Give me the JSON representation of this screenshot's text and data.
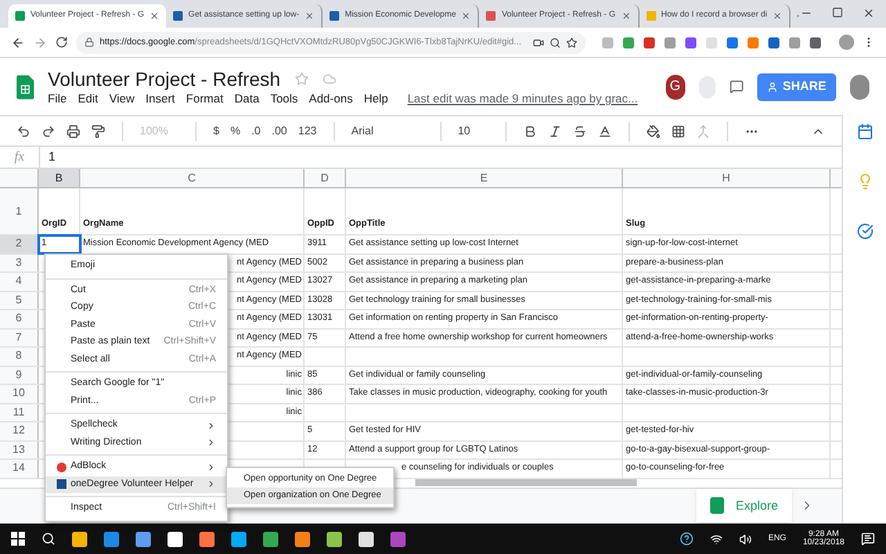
{
  "browser": {
    "tabs": [
      {
        "title": "Volunteer Project - Refresh - G",
        "selected": true,
        "color": "#0f9d58"
      },
      {
        "title": "Get assistance setting up low-",
        "selected": false,
        "color": "#1a5fa8"
      },
      {
        "title": "Mission Economic Developme",
        "selected": false,
        "color": "#1a5fa8"
      },
      {
        "title": "Volunteer Project - Refresh - G",
        "selected": false,
        "color": "#d9534f"
      },
      {
        "title": "How do I record a browser di",
        "selected": false,
        "color": "#f4b400"
      }
    ],
    "url_host": "https://docs.google.com",
    "url_path": "/spreadsheets/d/1GQHctVXOMtdzRU80pVg50CJGKWI6-Tlxb8TajNrKU/edit#gid..."
  },
  "doc": {
    "title": "Volunteer Project - Refresh",
    "menu": [
      "File",
      "Edit",
      "View",
      "Insert",
      "Format",
      "Data",
      "Tools",
      "Add-ons",
      "Help"
    ],
    "last_edit": "Last edit was made 9 minutes ago by grac...",
    "avatar_letter": "G",
    "share": "SHARE"
  },
  "toolbar": {
    "zoom": "100%",
    "currency": "$",
    "percent": "%",
    "decrease_decimals": ".0",
    "increase_decimals": ".00",
    "number_format": "123",
    "font": "Arial",
    "font_size": "10"
  },
  "formula_bar": {
    "label": "fx",
    "value": "1"
  },
  "grid": {
    "columns": [
      {
        "label": "B",
        "selected": true
      },
      {
        "label": "C",
        "selected": false
      },
      {
        "label": "D",
        "selected": false
      },
      {
        "label": "E",
        "selected": false
      },
      {
        "label": "H",
        "selected": false
      }
    ],
    "header_row": {
      "number": "1",
      "cells": [
        "OrgID",
        "OrgName",
        "OppID",
        "OppTitle",
        "Slug"
      ]
    },
    "rows": [
      {
        "number": "2",
        "selected": true,
        "b": "1",
        "c": "Mission Economic Development Agency (MED",
        "d": "3911",
        "e": "Get assistance setting up low-cost Internet",
        "h": "sign-up-for-low-cost-internet"
      },
      {
        "number": "3",
        "selected": false,
        "c": "nt Agency (MED",
        "d": "5002",
        "e": "Get assistance in preparing a business plan",
        "h": "prepare-a-business-plan"
      },
      {
        "number": "4",
        "selected": false,
        "c": "nt Agency (MED",
        "d": "13027",
        "e": "Get assistance in preparing a marketing plan",
        "h": "get-assistance-in-preparing-a-marke"
      },
      {
        "number": "5",
        "selected": false,
        "c": "nt Agency (MED",
        "d": "13028",
        "e": "Get technology training for small businesses",
        "h": "get-technology-training-for-small-mis"
      },
      {
        "number": "6",
        "selected": false,
        "c": "nt Agency (MED",
        "d": "13031",
        "e": "Get information on renting property in San Francisco",
        "h": "get-information-on-renting-property-"
      },
      {
        "number": "7",
        "selected": false,
        "c": "nt Agency (MED",
        "d": "75",
        "e": "Attend a free home ownership workshop for current homeowners",
        "h": "attend-a-free-home-ownership-works"
      },
      {
        "number": "8",
        "selected": false,
        "c": "nt Agency (MED"
      },
      {
        "number": "9",
        "selected": false,
        "c": "linic",
        "d": "85",
        "e": "Get individual or family counseling",
        "h": "get-individual-or-family-counseling"
      },
      {
        "number": "10",
        "selected": false,
        "c": "linic",
        "d": "386",
        "e": "Take classes in music production, videography, cooking for youth",
        "h": "take-classes-in-music-production-3r"
      },
      {
        "number": "11",
        "selected": false,
        "c": "linic"
      },
      {
        "number": "12",
        "selected": false,
        "d": "5",
        "e": "Get tested for HIV",
        "h": "get-tested-for-hiv"
      },
      {
        "number": "13",
        "selected": false,
        "d": "12",
        "e": "Attend a support group for LGBTQ Latinos",
        "h": "go-to-a-gay-bisexual-support-group-"
      },
      {
        "number": "14",
        "selected": false,
        "e": "e counseling for individuals or couples",
        "h": "go-to-counseling-for-free"
      }
    ]
  },
  "context_menu": {
    "items": [
      {
        "kind": "item",
        "label": "Emoji",
        "selected": false
      },
      {
        "kind": "separator"
      },
      {
        "kind": "item",
        "label": "Cut",
        "shortcut": "Ctrl+X",
        "selected": false
      },
      {
        "kind": "item",
        "label": "Copy",
        "shortcut": "Ctrl+C",
        "selected": false
      },
      {
        "kind": "item",
        "label": "Paste",
        "shortcut": "Ctrl+V",
        "selected": false
      },
      {
        "kind": "item",
        "label": "Paste as plain text",
        "shortcut": "Ctrl+Shift+V",
        "selected": false
      },
      {
        "kind": "item",
        "label": "Select all",
        "shortcut": "Ctrl+A",
        "selected": false
      },
      {
        "kind": "separator"
      },
      {
        "kind": "item",
        "label": "Search Google for \"1\"",
        "selected": false
      },
      {
        "kind": "item",
        "label": "Print...",
        "shortcut": "Ctrl+P",
        "selected": false
      },
      {
        "kind": "separator"
      },
      {
        "kind": "submenu",
        "label": "Spellcheck",
        "selected": false
      },
      {
        "kind": "submenu",
        "label": "Writing Direction",
        "selected": false
      },
      {
        "kind": "separator"
      },
      {
        "kind": "stopsign",
        "label": "AdBlock",
        "selected": false
      },
      {
        "kind": "extension",
        "label": "oneDegree Volunteer Helper",
        "selected": true
      },
      {
        "kind": "separator"
      },
      {
        "kind": "item",
        "label": "Inspect",
        "shortcut": "Ctrl+Shift+I",
        "selected": false
      }
    ]
  },
  "submenu": {
    "items": [
      {
        "label": "Open opportunity on One Degree",
        "selected": false
      },
      {
        "label": "Open organization on One Degree",
        "selected": true
      }
    ]
  },
  "explore": "Explore",
  "taskbar": {
    "time": "9:28 AM",
    "date": "10/23/2018",
    "language": "ENG"
  }
}
